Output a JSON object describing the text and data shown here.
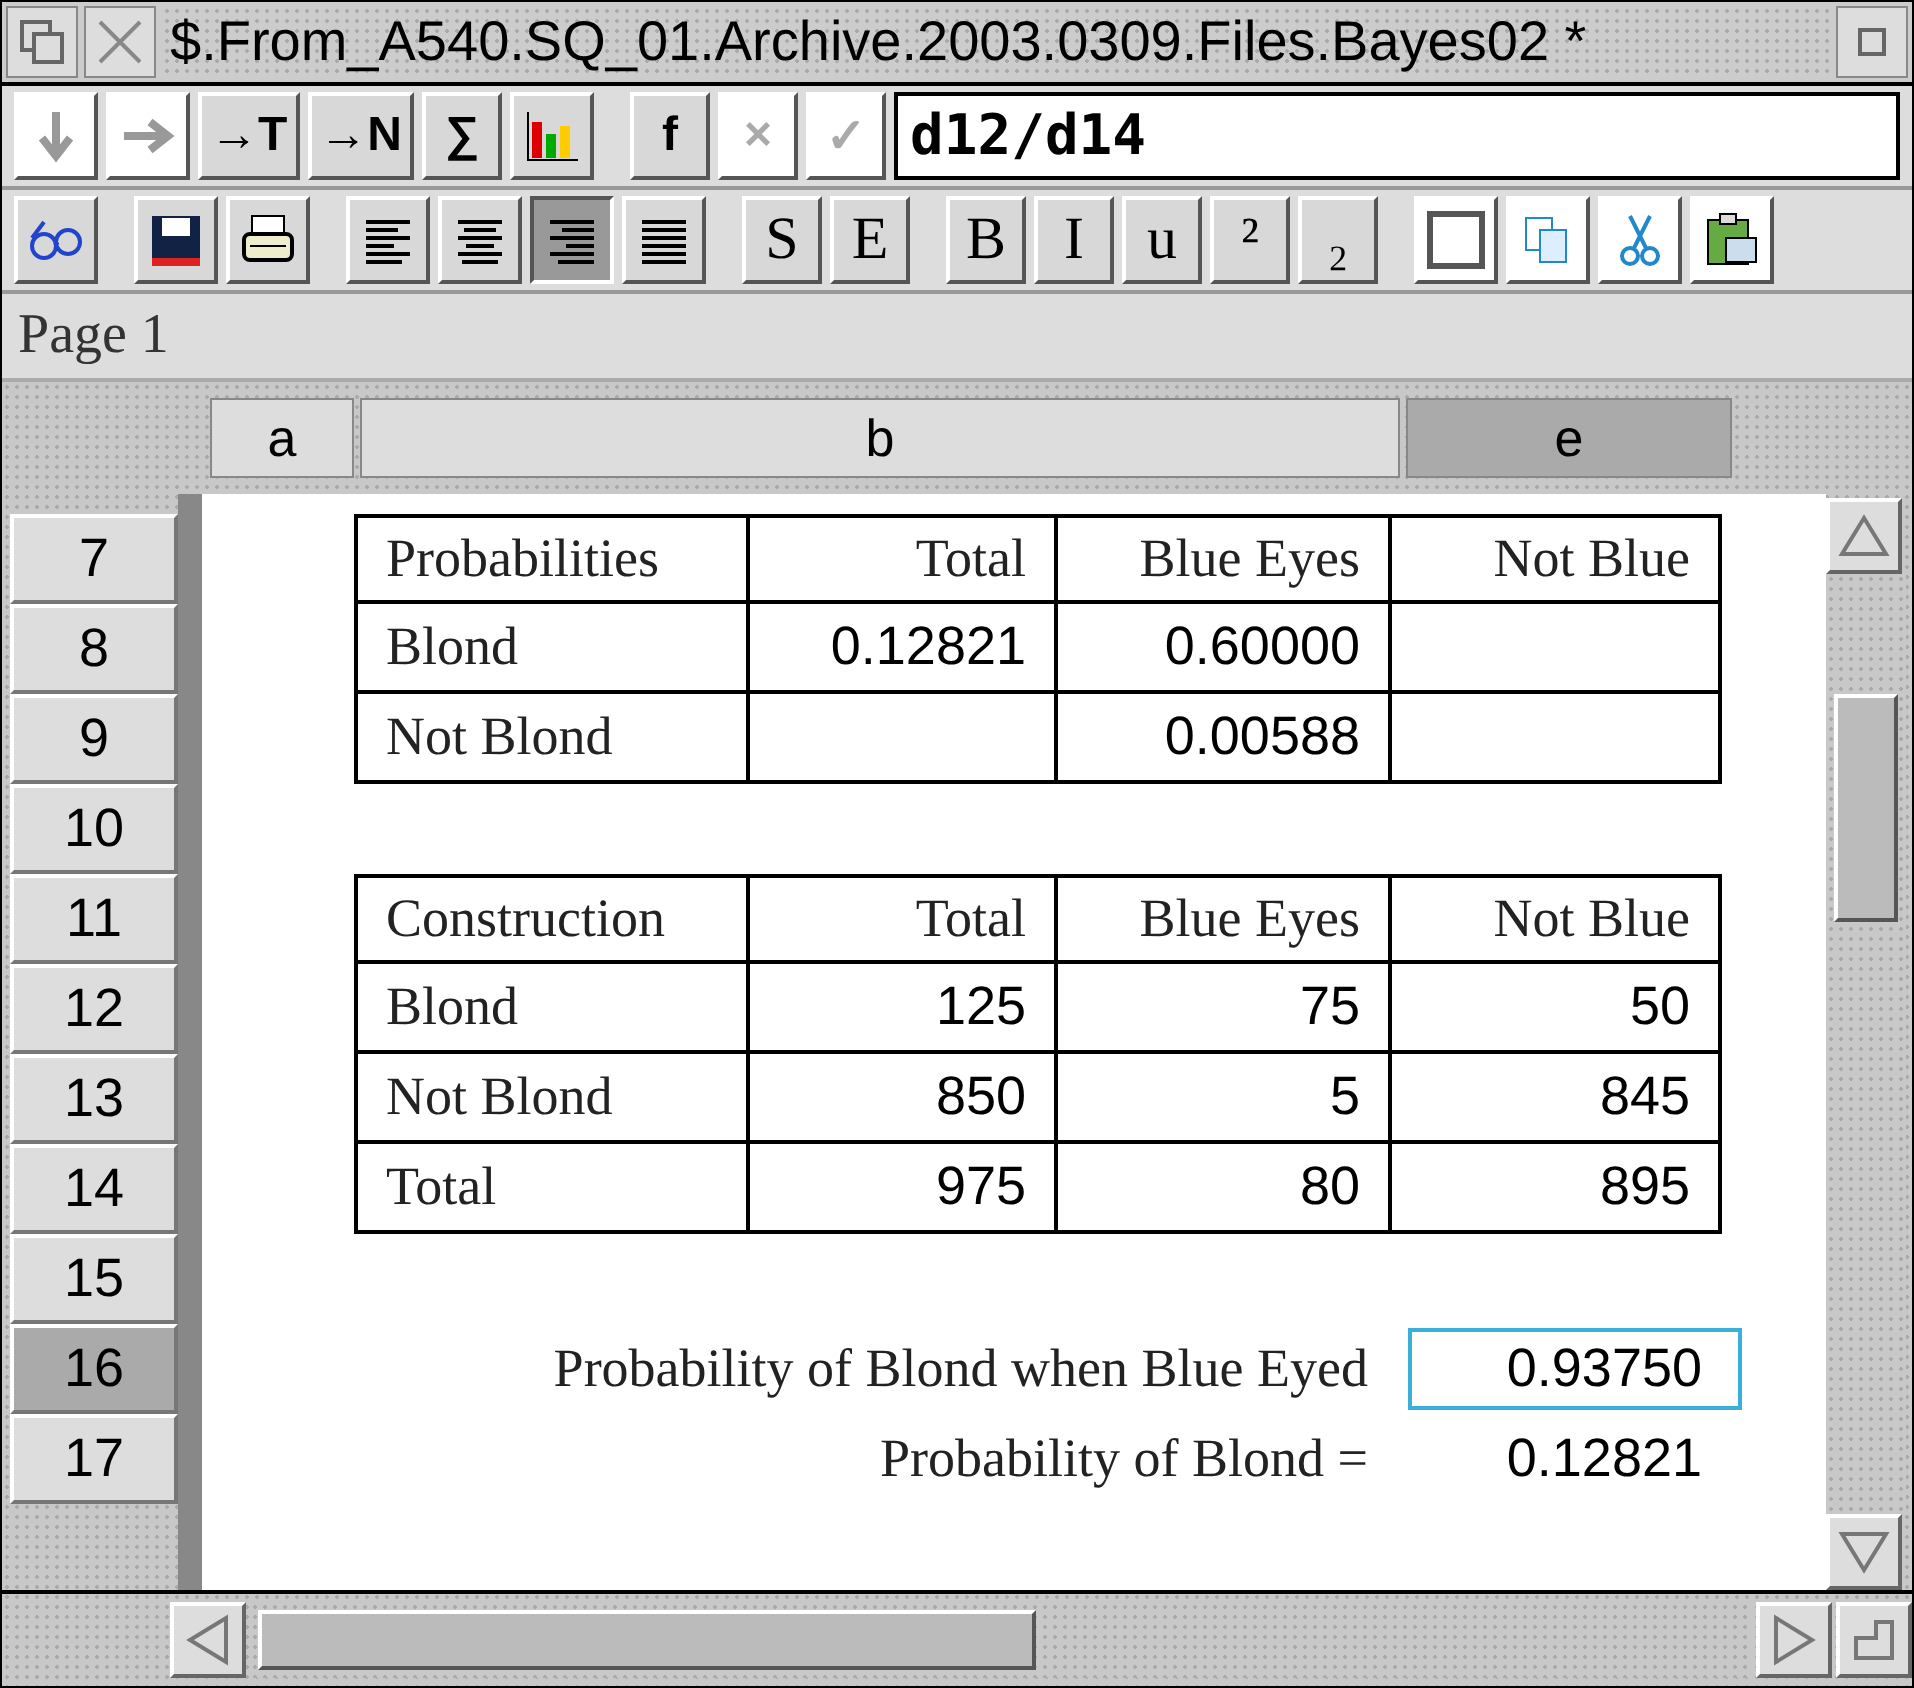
{
  "window": {
    "title": "$.From_A540.SQ_01.Archive.2003.0309.Files.Bayes02 *"
  },
  "formula_bar": {
    "buttons": [
      {
        "kind": "filldown",
        "disabled": true
      },
      {
        "kind": "fillright",
        "disabled": true
      },
      {
        "kind": "text",
        "label": "→T",
        "disabled": false
      },
      {
        "kind": "text",
        "label": "→N",
        "disabled": false
      },
      {
        "kind": "text",
        "label": "∑",
        "disabled": false
      },
      {
        "kind": "chart",
        "disabled": false
      },
      {
        "kind": "text",
        "label": "f",
        "disabled": false
      },
      {
        "kind": "text",
        "label": "×",
        "disabled": true
      },
      {
        "kind": "text",
        "label": "✓",
        "disabled": true
      }
    ],
    "value": "d12/d14"
  },
  "toolbar": [
    {
      "kind": "glasses"
    },
    {
      "kind": "save"
    },
    {
      "kind": "print"
    },
    {
      "kind": "alignleft",
      "selected": false
    },
    {
      "kind": "aligncenter",
      "selected": false
    },
    {
      "kind": "alignright",
      "selected": true
    },
    {
      "kind": "justify",
      "selected": false
    },
    {
      "kind": "text",
      "label": "S"
    },
    {
      "kind": "text",
      "label": "E"
    },
    {
      "kind": "text",
      "label": "B"
    },
    {
      "kind": "text",
      "label": "I"
    },
    {
      "kind": "text",
      "label": "u"
    },
    {
      "kind": "text",
      "label": "²"
    },
    {
      "kind": "text",
      "label": "₂"
    },
    {
      "kind": "box"
    },
    {
      "kind": "copy"
    },
    {
      "kind": "cut"
    },
    {
      "kind": "paste"
    }
  ],
  "page_label": "Page 1",
  "columns": [
    {
      "label": "a",
      "selected": false
    },
    {
      "label": "b",
      "selected": false
    },
    {
      "label": "e",
      "selected": true
    }
  ],
  "rows": [
    {
      "number": "7",
      "selected": false,
      "kind": "header",
      "cells": [
        "Probabilities",
        "Total",
        "Blue Eyes",
        "Not Blue"
      ]
    },
    {
      "number": "8",
      "selected": false,
      "kind": "data",
      "cells": [
        "Blond",
        "0.12821",
        "0.60000",
        ""
      ]
    },
    {
      "number": "9",
      "selected": false,
      "kind": "data",
      "cells": [
        "Not Blond",
        "",
        "0.00588",
        ""
      ]
    },
    {
      "number": "10",
      "selected": false,
      "kind": "blank"
    },
    {
      "number": "11",
      "selected": false,
      "kind": "header",
      "cells": [
        "Construction",
        "Total",
        "Blue Eyes",
        "Not Blue"
      ]
    },
    {
      "number": "12",
      "selected": false,
      "kind": "data",
      "cells": [
        "Blond",
        "125",
        "75",
        "50"
      ]
    },
    {
      "number": "13",
      "selected": false,
      "kind": "data",
      "cells": [
        "Not Blond",
        "850",
        "5",
        "845"
      ]
    },
    {
      "number": "14",
      "selected": false,
      "kind": "data",
      "cells": [
        "Total",
        "975",
        "80",
        "895"
      ]
    },
    {
      "number": "15",
      "selected": false,
      "kind": "blank"
    },
    {
      "number": "16",
      "selected": true,
      "kind": "result",
      "label": "Probability of Blond when Blue Eyed",
      "value": "0.93750",
      "value_selected": true
    },
    {
      "number": "17",
      "selected": false,
      "kind": "result",
      "label": "Probability of Blond =",
      "value": "0.12821",
      "value_selected": false
    }
  ]
}
